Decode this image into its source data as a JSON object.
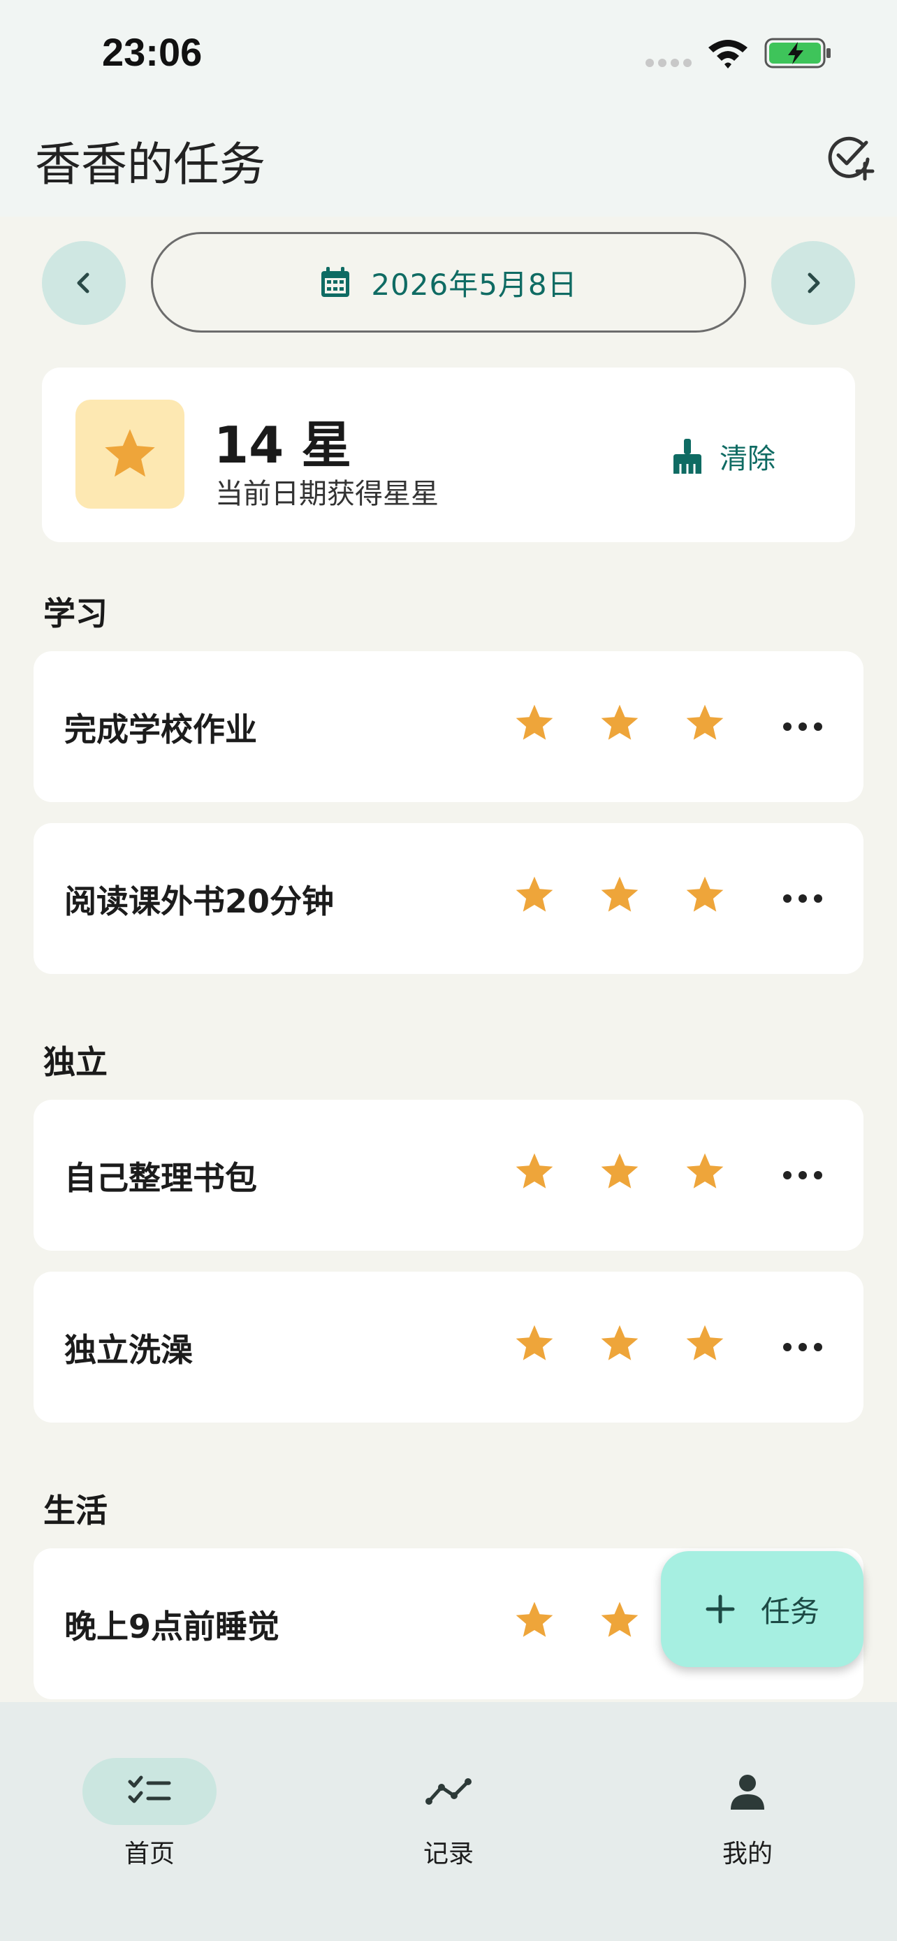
{
  "status_bar": {
    "time": "23:06"
  },
  "app_bar": {
    "title": "香香的任务"
  },
  "date_nav": {
    "date": "2026年5月8日"
  },
  "summary": {
    "stars": "14 星",
    "subtitle": "当前日期获得星星",
    "clear_label": "清除"
  },
  "colors": {
    "accent": "#0f6b63",
    "star": "#eea53a",
    "fab": "#a6efe1",
    "nav_active": "#cbe6e0"
  },
  "sections": [
    {
      "title": "学习",
      "tasks": [
        {
          "name": "完成学校作业",
          "stars": 3
        },
        {
          "name": "阅读课外书20分钟",
          "stars": 3
        }
      ]
    },
    {
      "title": "独立",
      "tasks": [
        {
          "name": "自己整理书包",
          "stars": 3
        },
        {
          "name": "独立洗澡",
          "stars": 3
        }
      ]
    },
    {
      "title": "生活",
      "tasks": [
        {
          "name": "晚上9点前睡觉",
          "stars": 3
        }
      ]
    }
  ],
  "fab": {
    "label": "任务"
  },
  "bottom_nav": [
    {
      "label": "首页",
      "icon": "task-list-icon",
      "active": true
    },
    {
      "label": "记录",
      "icon": "line-chart-icon",
      "active": false
    },
    {
      "label": "我的",
      "icon": "person-icon",
      "active": false
    }
  ]
}
